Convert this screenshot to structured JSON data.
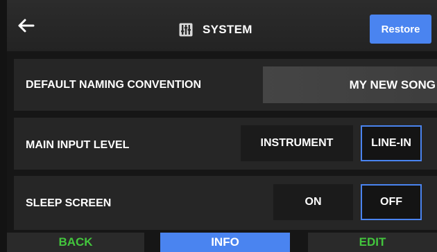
{
  "header": {
    "title": "SYSTEM",
    "restore_label": "Restore",
    "back_icon": "arrow-left-icon",
    "system_icon": "sliders-icon"
  },
  "settings": {
    "naming": {
      "label": "DEFAULT NAMING CONVENTION",
      "value": "MY NEW SONG"
    },
    "input_level": {
      "label": "MAIN INPUT LEVEL",
      "options": [
        "INSTRUMENT",
        "LINE-IN"
      ],
      "selected": "LINE-IN"
    },
    "sleep_screen": {
      "label": "SLEEP SCREEN",
      "options": [
        "ON",
        "OFF"
      ],
      "selected": "OFF"
    }
  },
  "footer": {
    "back_label": "BACK",
    "info_label": "INFO",
    "edit_label": "EDIT"
  },
  "colors": {
    "accent": "#4a84f0",
    "green": "#43c63d",
    "background": "#161616",
    "row": "#262626"
  }
}
